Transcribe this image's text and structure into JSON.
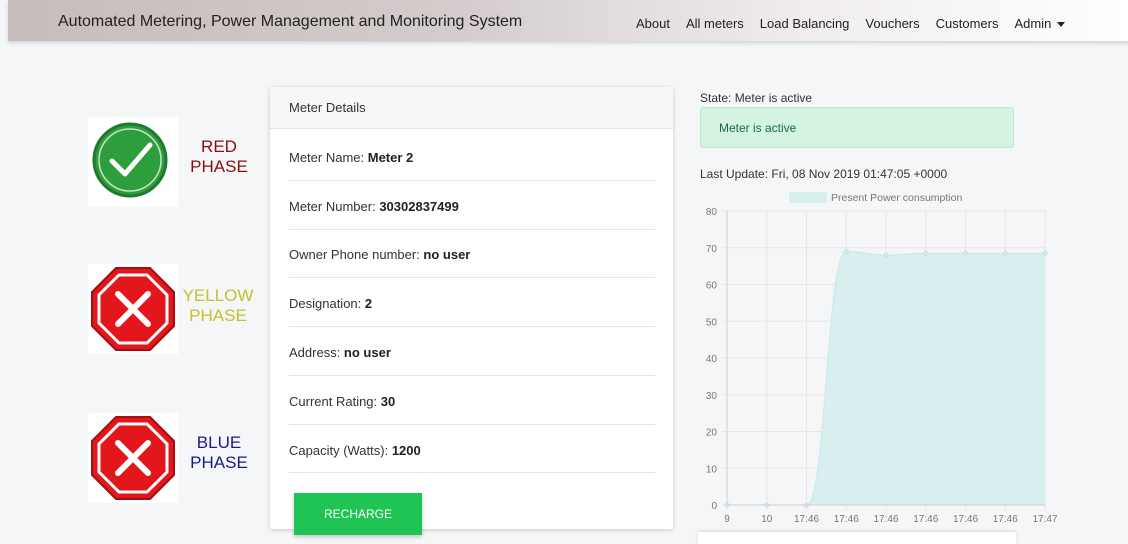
{
  "navbar": {
    "brand": "Automated Metering, Power Management and Monitoring System",
    "items": [
      "About",
      "All meters",
      "Load Balancing",
      "Vouchers",
      "Customers",
      "Admin"
    ]
  },
  "phases": [
    {
      "line1": "RED",
      "line2": "PHASE",
      "status": "ok",
      "color": "#8b0d0d"
    },
    {
      "line1": "YELLOW",
      "line2": "PHASE",
      "status": "error",
      "color": "#c6c12a"
    },
    {
      "line1": "BLUE",
      "line2": "PHASE",
      "status": "error",
      "color": "#1a1a8a"
    }
  ],
  "meter_details": {
    "header": "Meter Details",
    "rows": [
      {
        "label": "Meter Name: ",
        "value": "Meter 2"
      },
      {
        "label": "Meter Number: ",
        "value": "30302837499"
      },
      {
        "label": "Owner Phone number: ",
        "value": "no user"
      },
      {
        "label": "Designation: ",
        "value": "2"
      },
      {
        "label": "Address: ",
        "value": "no user"
      },
      {
        "label": "Current Rating: ",
        "value": "30"
      },
      {
        "label": "Capacity (Watts): ",
        "value": "1200"
      }
    ],
    "recharge_label": "RECHARGE"
  },
  "status": {
    "state_text": "State: Meter is active",
    "alert_text": "Meter is active",
    "last_update": "Last Update: Fri, 08 Nov 2019 01:47:05 +0000"
  },
  "colors": {
    "accent_green": "#1fc454",
    "ok_green": "#2e9e3c",
    "stop_red": "#e3161b",
    "chart_fill": "#d9eeee"
  },
  "chart_data": {
    "type": "area",
    "legend": "Present Power consumption",
    "legend_position": "top-center",
    "categories": [
      "9",
      "10",
      "17:46",
      "17:46",
      "17:46",
      "17:46",
      "17:46",
      "17:46",
      "17:47"
    ],
    "values": [
      0,
      0,
      0,
      69,
      68,
      68.5,
      68.5,
      68.5,
      68.5
    ],
    "ylim": [
      0,
      80
    ],
    "yticks": [
      0,
      10,
      20,
      30,
      40,
      50,
      60,
      70,
      80
    ],
    "grid": true
  }
}
